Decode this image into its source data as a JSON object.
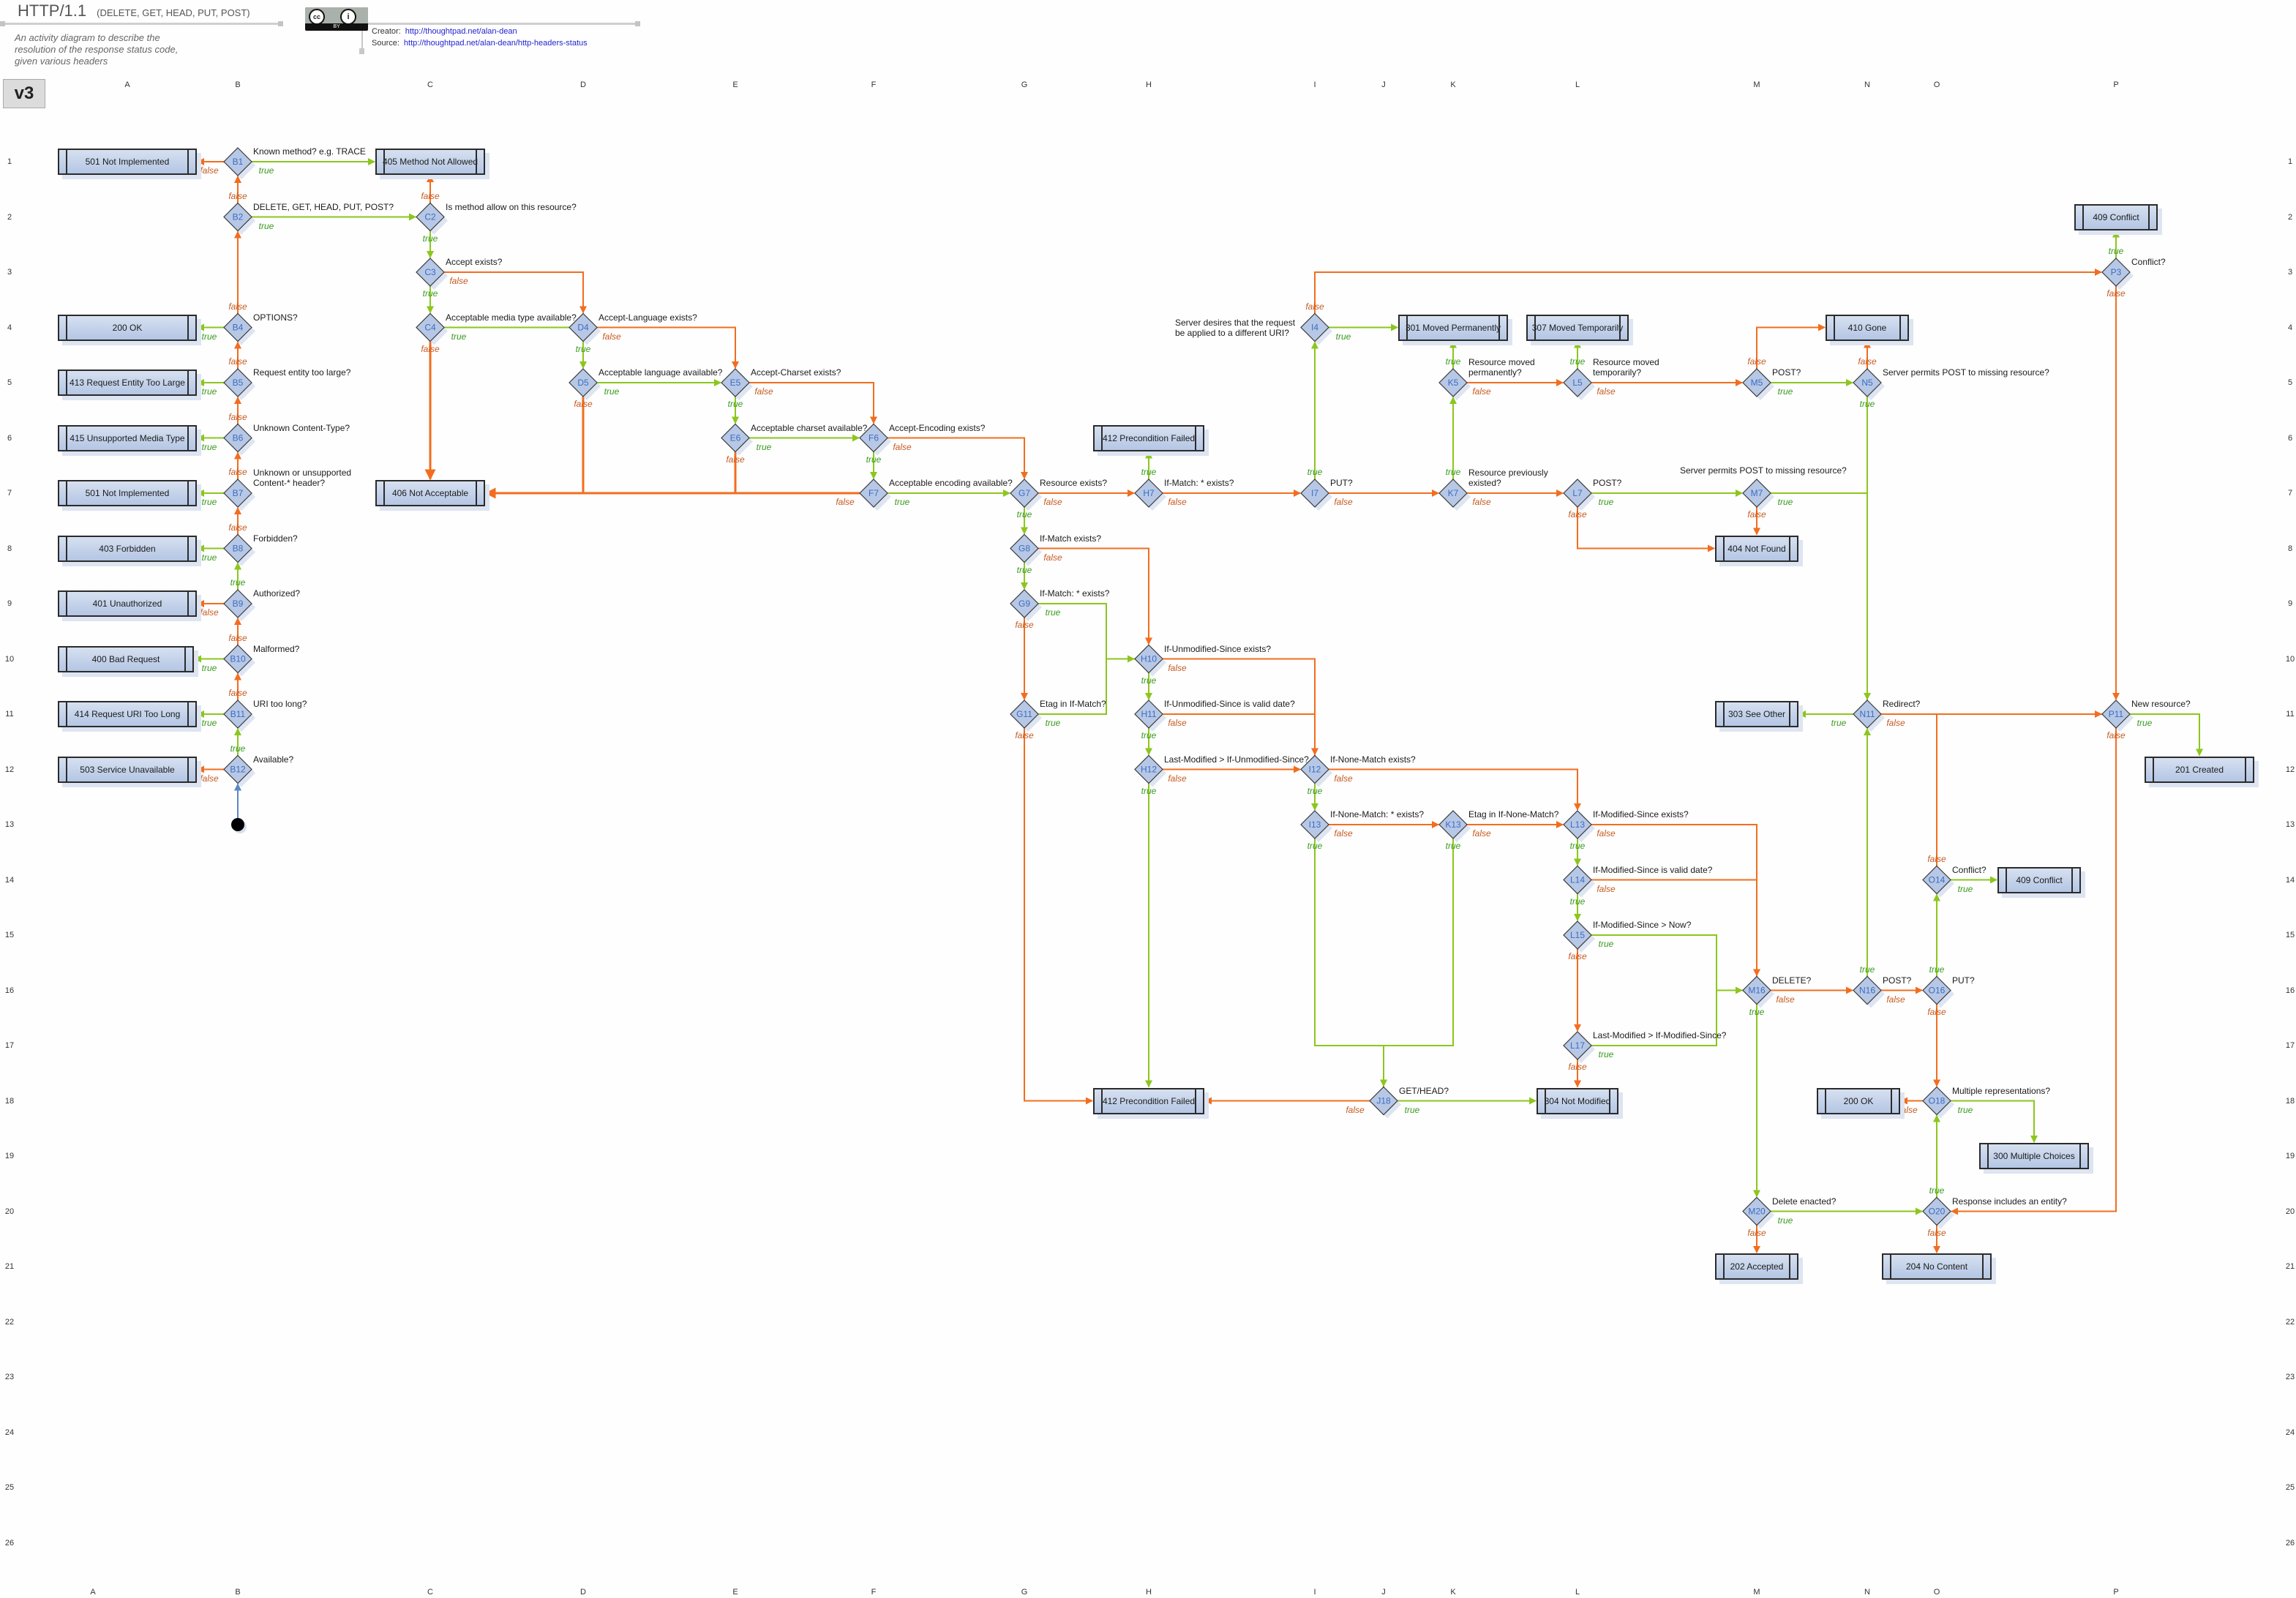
{
  "header": {
    "title": "HTTP/1.1",
    "subtitle": "(DELETE, GET, HEAD, PUT, POST)",
    "description": "An activity diagram to describe the resolution of the response status code, given various headers",
    "license_badge": {
      "cc": "cc",
      "by_icon": "i",
      "by": "BY"
    },
    "creator_label": "Creator:",
    "creator_link": "http://thoughtpad.net/alan-dean",
    "source_label": "Source:",
    "source_link": "http://thoughtpad.net/alan-dean/http-headers-status",
    "version": "v3"
  },
  "colors": {
    "true_edge": "#8cc61e",
    "false_edge": "#f26d1f",
    "start_edge": "#5b87c5",
    "true_text": "#3a9a1f",
    "false_text": "#c85a22",
    "node_fill": "#b7c8e6",
    "node_stroke": "#3a3a3a",
    "node_label": "#3c6cc0"
  },
  "grid": {
    "columns": [
      "A",
      "B",
      "C",
      "D",
      "E",
      "F",
      "G",
      "H",
      "I",
      "J",
      "K",
      "L",
      "M",
      "N",
      "O",
      "P"
    ],
    "rows": [
      "1",
      "2",
      "3",
      "4",
      "5",
      "6",
      "7",
      "8",
      "9",
      "10",
      "11",
      "12",
      "13",
      "14",
      "15",
      "16",
      "17",
      "18",
      "19",
      "20",
      "21",
      "22",
      "23",
      "24",
      "25",
      "26"
    ]
  },
  "start": {
    "cell": "B13"
  },
  "decisions": [
    {
      "id": "B1",
      "question": "Known method? e.g. TRACE"
    },
    {
      "id": "B2",
      "question": "DELETE, GET, HEAD, PUT, POST?"
    },
    {
      "id": "B4",
      "question": "OPTIONS?"
    },
    {
      "id": "B5",
      "question": "Request entity too large?"
    },
    {
      "id": "B6",
      "question": "Unknown Content-Type?"
    },
    {
      "id": "B7",
      "question": "Unknown or unsupported\nContent-* header?"
    },
    {
      "id": "B8",
      "question": "Forbidden?"
    },
    {
      "id": "B9",
      "question": "Authorized?"
    },
    {
      "id": "B10",
      "question": "Malformed?"
    },
    {
      "id": "B11",
      "question": "URI too long?"
    },
    {
      "id": "B12",
      "question": "Available?"
    },
    {
      "id": "C2",
      "question": "Is method allow on this resource?"
    },
    {
      "id": "C3",
      "question": "Accept exists?"
    },
    {
      "id": "C4",
      "question": "Acceptable media type available?"
    },
    {
      "id": "D4",
      "question": "Accept-Language exists?"
    },
    {
      "id": "D5",
      "question": "Acceptable language available?"
    },
    {
      "id": "E5",
      "question": "Accept-Charset exists?"
    },
    {
      "id": "E6",
      "question": "Acceptable charset available?"
    },
    {
      "id": "F6",
      "question": "Accept-Encoding exists?"
    },
    {
      "id": "F7",
      "question": "Acceptable encoding available?"
    },
    {
      "id": "G7",
      "question": "Resource exists?"
    },
    {
      "id": "G8",
      "question": "If-Match exists?"
    },
    {
      "id": "G9",
      "question": "If-Match: * exists?"
    },
    {
      "id": "G11",
      "question": "Etag in If-Match?"
    },
    {
      "id": "H7",
      "question": "If-Match: * exists?"
    },
    {
      "id": "H10",
      "question": "If-Unmodified-Since exists?"
    },
    {
      "id": "H11",
      "question": "If-Unmodified-Since is valid date?"
    },
    {
      "id": "H12",
      "question": "Last-Modified > If-Unmodified-Since?"
    },
    {
      "id": "I4",
      "question": "Server desires that the request\nbe applied to a different URI?",
      "question_side": "left"
    },
    {
      "id": "I7",
      "question": "PUT?"
    },
    {
      "id": "I12",
      "question": "If-None-Match exists?"
    },
    {
      "id": "I13",
      "question": "If-None-Match: * exists?"
    },
    {
      "id": "J18",
      "question": "GET/HEAD?"
    },
    {
      "id": "K5",
      "question": "Resource moved\npermanently?"
    },
    {
      "id": "K7",
      "question": "Resource previously\nexisted?"
    },
    {
      "id": "K13",
      "question": "Etag in If-None-Match?"
    },
    {
      "id": "L5",
      "question": "Resource moved\ntemporarily?"
    },
    {
      "id": "L7",
      "question": "POST?"
    },
    {
      "id": "L13",
      "question": "If-Modified-Since exists?"
    },
    {
      "id": "L14",
      "question": "If-Modified-Since is valid date?"
    },
    {
      "id": "L15",
      "question": "If-Modified-Since > Now?"
    },
    {
      "id": "L17",
      "question": "Last-Modified > If-Modified-Since?"
    },
    {
      "id": "M5",
      "question": "POST?"
    },
    {
      "id": "M7",
      "question": "Server permits POST to missing resource?",
      "question_side": "above"
    },
    {
      "id": "M16",
      "question": "DELETE?"
    },
    {
      "id": "M20",
      "question": "Delete enacted?"
    },
    {
      "id": "N5",
      "question": "Server permits POST to missing resource?"
    },
    {
      "id": "N11",
      "question": "Redirect?"
    },
    {
      "id": "N16",
      "question": "POST?"
    },
    {
      "id": "O14",
      "question": "Conflict?"
    },
    {
      "id": "O16",
      "question": "PUT?"
    },
    {
      "id": "O18",
      "question": "Multiple representations?"
    },
    {
      "id": "O20",
      "question": "Response includes an entity?"
    },
    {
      "id": "P3",
      "question": "Conflict?"
    },
    {
      "id": "P11",
      "question": "New resource?"
    }
  ],
  "outcomes": [
    {
      "key": "A1",
      "label": "501 Not Implemented"
    },
    {
      "key": "A4",
      "label": "200 OK"
    },
    {
      "key": "A5",
      "label": "413 Request Entity Too Large"
    },
    {
      "key": "A6",
      "label": "415 Unsupported Media Type"
    },
    {
      "key": "A7",
      "label": "501 Not Implemented"
    },
    {
      "key": "A8",
      "label": "403 Forbidden"
    },
    {
      "key": "A9",
      "label": "401 Unauthorized"
    },
    {
      "key": "A10",
      "label": "400 Bad Request"
    },
    {
      "key": "A11",
      "label": "414 Request URI Too Long"
    },
    {
      "key": "A12",
      "label": "503 Service Unavailable"
    },
    {
      "key": "C1",
      "label": "405 Method Not Allowed"
    },
    {
      "key": "C7",
      "label": "406 Not Acceptable"
    },
    {
      "key": "H6",
      "label": "412 Precondition Failed"
    },
    {
      "key": "H18",
      "label": "412 Precondition Failed"
    },
    {
      "key": "K4",
      "label": "301 Moved Permanently"
    },
    {
      "key": "L4",
      "label": "307 Moved Temporarily"
    },
    {
      "key": "K18",
      "label": "304 Not Modified"
    },
    {
      "key": "M8",
      "label": "404 Not Found"
    },
    {
      "key": "N4",
      "label": "410 Gone"
    },
    {
      "key": "M11",
      "label": "303 See Other"
    },
    {
      "key": "P2",
      "label": "409 Conflict"
    },
    {
      "key": "Q12",
      "label": "201 Created"
    },
    {
      "key": "O14b",
      "label": "409 Conflict"
    },
    {
      "key": "M18",
      "label": "200 OK"
    },
    {
      "key": "O19",
      "label": "300 Multiple Choices"
    },
    {
      "key": "M21",
      "label": "202 Accepted"
    },
    {
      "key": "O21",
      "label": "204 No Content"
    }
  ],
  "edges": [
    {
      "from": "START",
      "to": "B12",
      "kind": "start"
    },
    {
      "from": "B12",
      "to": "B11",
      "kind": "true"
    },
    {
      "from": "B12",
      "to": "A12",
      "kind": "false"
    },
    {
      "from": "B11",
      "to": "A11",
      "kind": "true"
    },
    {
      "from": "B11",
      "to": "B10",
      "kind": "false"
    },
    {
      "from": "B10",
      "to": "A10",
      "kind": "true"
    },
    {
      "from": "B10",
      "to": "B9",
      "kind": "false"
    },
    {
      "from": "B9",
      "to": "A9",
      "kind": "false"
    },
    {
      "from": "B9",
      "to": "B8",
      "kind": "true"
    },
    {
      "from": "B8",
      "to": "A8",
      "kind": "true"
    },
    {
      "from": "B8",
      "to": "B7",
      "kind": "false"
    },
    {
      "from": "B7",
      "to": "A7",
      "kind": "true"
    },
    {
      "from": "B7",
      "to": "B6",
      "kind": "false"
    },
    {
      "from": "B6",
      "to": "A6",
      "kind": "true"
    },
    {
      "from": "B6",
      "to": "B5",
      "kind": "false"
    },
    {
      "from": "B5",
      "to": "A5",
      "kind": "true"
    },
    {
      "from": "B5",
      "to": "B4",
      "kind": "false"
    },
    {
      "from": "B4",
      "to": "A4",
      "kind": "true"
    },
    {
      "from": "B4",
      "to": "B2",
      "kind": "false"
    },
    {
      "from": "B2",
      "to": "C2",
      "kind": "true"
    },
    {
      "from": "B2",
      "to": "B1",
      "kind": "false"
    },
    {
      "from": "B1",
      "to": "C1",
      "kind": "true"
    },
    {
      "from": "B1",
      "to": "A1",
      "kind": "false"
    },
    {
      "from": "C2",
      "to": "C1",
      "kind": "false"
    },
    {
      "from": "C2",
      "to": "C3",
      "kind": "true"
    },
    {
      "from": "C3",
      "to": "C4",
      "kind": "true"
    },
    {
      "from": "C3",
      "to": "D4",
      "kind": "false",
      "via": [
        "D3"
      ]
    },
    {
      "from": "C4",
      "to": "D4",
      "kind": "true",
      "noarrow": true
    },
    {
      "from": "C4",
      "to": "C7",
      "kind": "false"
    },
    {
      "from": "D4",
      "to": "D5",
      "kind": "true"
    },
    {
      "from": "D4",
      "to": "E5",
      "kind": "false",
      "via": [
        "E4"
      ]
    },
    {
      "from": "D5",
      "to": "E5",
      "kind": "true"
    },
    {
      "from": "D5",
      "to": "C7",
      "kind": "false",
      "via": [
        "D7"
      ],
      "noarrow": true
    },
    {
      "from": "E5",
      "to": "E6",
      "kind": "true"
    },
    {
      "from": "E5",
      "to": "F6",
      "kind": "false",
      "via": [
        "F5"
      ]
    },
    {
      "from": "E6",
      "to": "F6",
      "kind": "true"
    },
    {
      "from": "E6",
      "to": "C7",
      "kind": "false",
      "via": [
        "E7"
      ],
      "noarrow": true
    },
    {
      "from": "F6",
      "to": "F7",
      "kind": "true"
    },
    {
      "from": "F6",
      "to": "G7",
      "kind": "false",
      "via": [
        "G6"
      ]
    },
    {
      "from": "F7",
      "to": "G7",
      "kind": "true"
    },
    {
      "from": "F7",
      "to": "C7",
      "kind": "false"
    },
    {
      "from": "G7",
      "to": "G8",
      "kind": "true"
    },
    {
      "from": "G7",
      "to": "H7",
      "kind": "false"
    },
    {
      "from": "H7",
      "to": "H6",
      "kind": "true"
    },
    {
      "from": "H7",
      "to": "I7",
      "kind": "false"
    },
    {
      "from": "G8",
      "to": "G9",
      "kind": "true"
    },
    {
      "from": "G8",
      "to": "H10",
      "kind": "false",
      "via": [
        "H8"
      ]
    },
    {
      "from": "G9",
      "to": "H10",
      "kind": "true",
      "via": [
        "G9.x+",
        "G10.x+"
      ]
    },
    {
      "from": "G9",
      "to": "G11",
      "kind": "false"
    },
    {
      "from": "G11",
      "to": "H10",
      "kind": "true",
      "via": [
        "G11.x+",
        "G10.x+"
      ],
      "noarrow": true
    },
    {
      "from": "G11",
      "to": "H18",
      "kind": "false",
      "via": [
        "G18"
      ]
    },
    {
      "from": "H10",
      "to": "H11",
      "kind": "true"
    },
    {
      "from": "H10",
      "to": "I12",
      "kind": "false",
      "via": [
        "I10"
      ]
    },
    {
      "from": "H11",
      "to": "H12",
      "kind": "true"
    },
    {
      "from": "H11",
      "to": "I12",
      "kind": "false",
      "via": [
        "I11"
      ],
      "noarrow": true
    },
    {
      "from": "H12",
      "to": "H18",
      "kind": "true"
    },
    {
      "from": "H12",
      "to": "I12",
      "kind": "false"
    },
    {
      "from": "I7",
      "to": "I4",
      "kind": "true"
    },
    {
      "from": "I7",
      "to": "K7",
      "kind": "false"
    },
    {
      "from": "I4",
      "to": "K4",
      "kind": "true"
    },
    {
      "from": "I4",
      "to": "P3",
      "kind": "false",
      "via": [
        "I3"
      ]
    },
    {
      "from": "K7",
      "to": "K5",
      "kind": "true"
    },
    {
      "from": "K7",
      "to": "L7",
      "kind": "false"
    },
    {
      "from": "K5",
      "to": "K4",
      "kind": "true"
    },
    {
      "from": "K5",
      "to": "L5",
      "kind": "false"
    },
    {
      "from": "L5",
      "to": "L4",
      "kind": "true"
    },
    {
      "from": "L5",
      "to": "M5",
      "kind": "false"
    },
    {
      "from": "L7",
      "to": "M7",
      "kind": "true"
    },
    {
      "from": "L7",
      "to": "M8",
      "kind": "false",
      "via": [
        "L8"
      ]
    },
    {
      "from": "M5",
      "to": "N5",
      "kind": "true"
    },
    {
      "from": "M5",
      "to": "N4",
      "kind": "false",
      "via": [
        "M4"
      ]
    },
    {
      "from": "N5",
      "to": "N4",
      "kind": "false"
    },
    {
      "from": "N5",
      "to": "N11",
      "kind": "true"
    },
    {
      "from": "M7",
      "to": "N11",
      "kind": "true",
      "via": [
        "N7"
      ],
      "noarrow": true
    },
    {
      "from": "M7",
      "to": "M8",
      "kind": "false"
    },
    {
      "from": "P3",
      "to": "P2",
      "kind": "true"
    },
    {
      "from": "P3",
      "to": "P11",
      "kind": "false"
    },
    {
      "from": "I12",
      "to": "I13",
      "kind": "true"
    },
    {
      "from": "I12",
      "to": "L13",
      "kind": "false",
      "via": [
        "L12"
      ]
    },
    {
      "from": "I13",
      "to": "K13",
      "kind": "false"
    },
    {
      "from": "I13",
      "to": "J18",
      "kind": "true",
      "via": [
        "I17",
        "J17"
      ]
    },
    {
      "from": "K13",
      "to": "L13",
      "kind": "false"
    },
    {
      "from": "K13",
      "to": "J18",
      "kind": "true",
      "via": [
        "K17",
        "J17"
      ],
      "noarrow": true
    },
    {
      "from": "J18",
      "to": "K18",
      "kind": "true"
    },
    {
      "from": "J18",
      "to": "H18",
      "kind": "false"
    },
    {
      "from": "L13",
      "to": "L14",
      "kind": "true"
    },
    {
      "from": "L13",
      "to": "M16",
      "kind": "false",
      "via": [
        "M13"
      ]
    },
    {
      "from": "L14",
      "to": "L15",
      "kind": "true"
    },
    {
      "from": "L14",
      "to": "M16",
      "kind": "false",
      "via": [
        "M14"
      ],
      "noarrow": true
    },
    {
      "from": "L15",
      "to": "L17",
      "kind": "false"
    },
    {
      "from": "L15",
      "to": "M16",
      "kind": "true",
      "via": [
        "L15.x++",
        "L16.x++"
      ]
    },
    {
      "from": "L17",
      "to": "K18",
      "kind": "false"
    },
    {
      "from": "L17",
      "to": "M16",
      "kind": "true",
      "via": [
        "L17.x++",
        "L16.x++"
      ],
      "noarrow": true
    },
    {
      "from": "M16",
      "to": "N16",
      "kind": "false"
    },
    {
      "from": "M16",
      "to": "M20",
      "kind": "true"
    },
    {
      "from": "N16",
      "to": "N11",
      "kind": "true"
    },
    {
      "from": "N16",
      "to": "O16",
      "kind": "false"
    },
    {
      "from": "O16",
      "to": "O14",
      "kind": "true"
    },
    {
      "from": "O16",
      "to": "O18",
      "kind": "false"
    },
    {
      "from": "O14",
      "to": "O14b",
      "kind": "true"
    },
    {
      "from": "O14",
      "to": "P11",
      "kind": "false",
      "via": [
        "O11"
      ],
      "noarrow": true
    },
    {
      "from": "N11",
      "to": "M11",
      "kind": "true"
    },
    {
      "from": "N11",
      "to": "P11",
      "kind": "false"
    },
    {
      "from": "P11",
      "to": "Q12",
      "kind": "true",
      "via": [
        "Q11"
      ]
    },
    {
      "from": "P11",
      "to": "O20",
      "kind": "false",
      "via": [
        "P20"
      ]
    },
    {
      "from": "O18",
      "to": "M18",
      "kind": "false"
    },
    {
      "from": "O18",
      "to": "O19",
      "kind": "true",
      "via": [
        "O18.x+"
      ]
    },
    {
      "from": "M20",
      "to": "O20",
      "kind": "true"
    },
    {
      "from": "M20",
      "to": "M21",
      "kind": "false"
    },
    {
      "from": "O20",
      "to": "O18",
      "kind": "true"
    },
    {
      "from": "O20",
      "to": "O21",
      "kind": "false"
    }
  ],
  "branch_labels": {
    "true": "true",
    "false": "false"
  }
}
